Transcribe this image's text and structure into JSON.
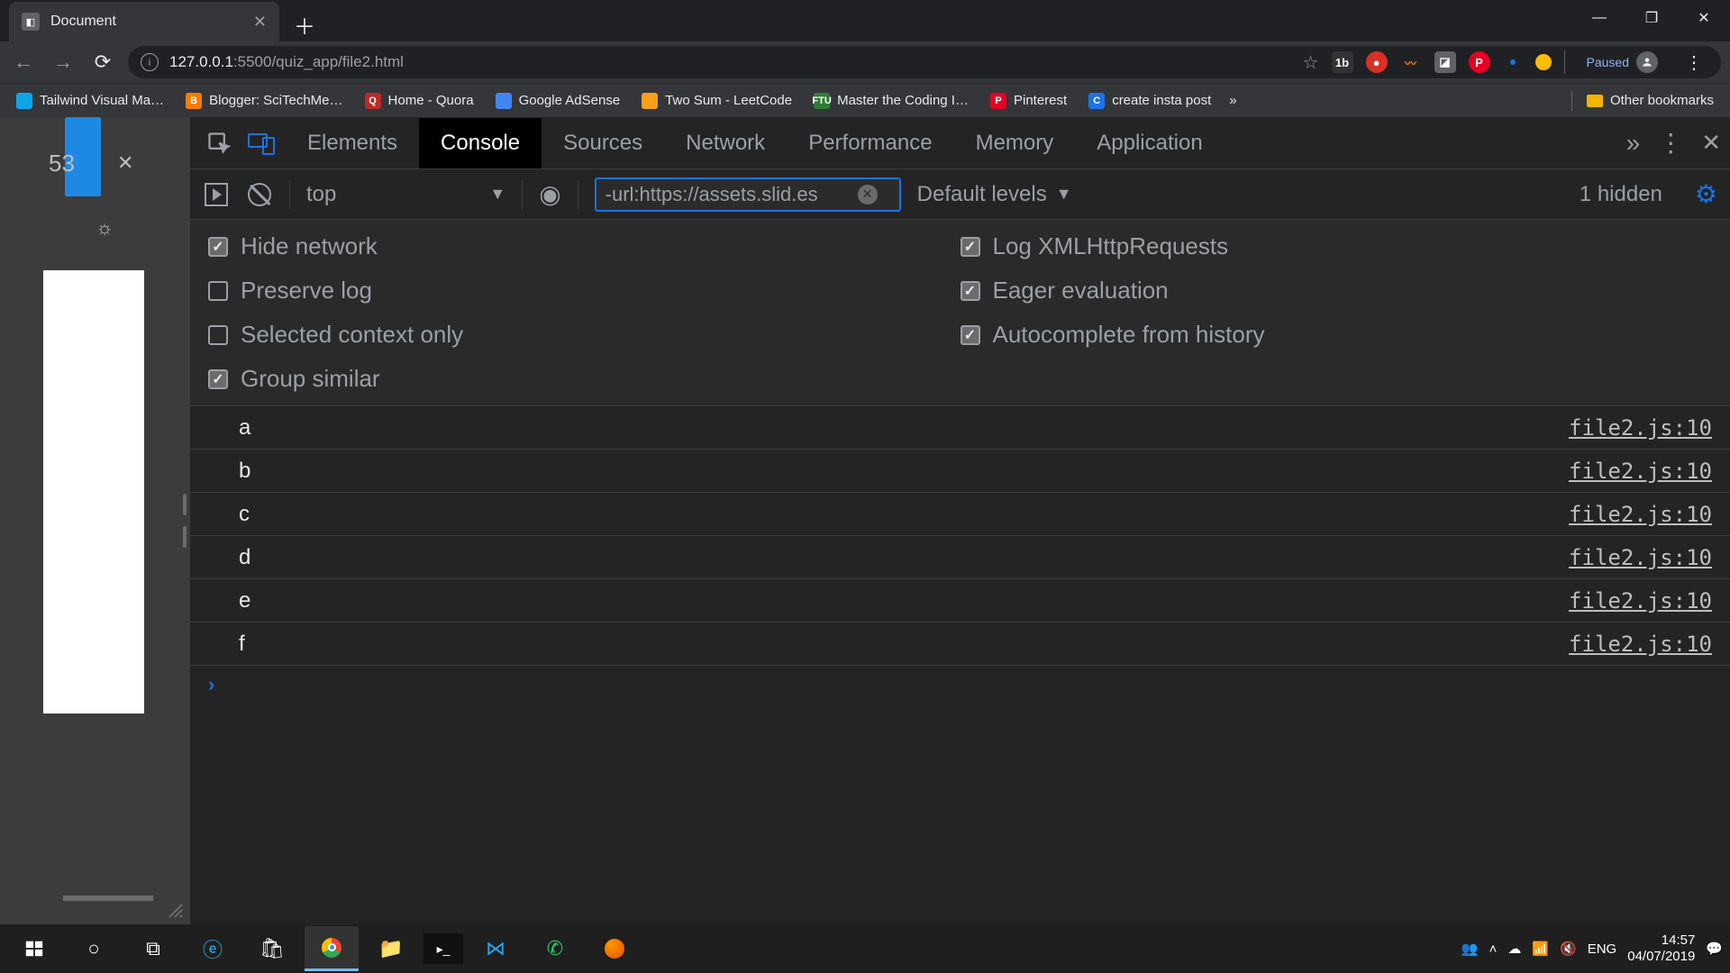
{
  "window": {
    "tab_title": "Document",
    "paused_label": "Paused"
  },
  "address": {
    "host": "127.0.0.1",
    "port": ":5500",
    "path": "/quiz_app/file2.html"
  },
  "bookmarks": {
    "items": [
      {
        "label": "Tailwind  Visual Ma…",
        "color": "#0ea5e9"
      },
      {
        "label": "Blogger: SciTechMe…",
        "color": "#f57c00",
        "initial": "B"
      },
      {
        "label": "Home - Quora",
        "color": "#b92b27",
        "initial": "Q"
      },
      {
        "label": "Google AdSense",
        "color": "#4285f4",
        "initial": ""
      },
      {
        "label": "Two Sum - LeetCode",
        "color": "#f89f1b",
        "initial": ""
      },
      {
        "label": "Master the Coding I…",
        "color": "#2e7d32",
        "initial": "FTU"
      },
      {
        "label": "Pinterest",
        "color": "#e60023",
        "initial": "P"
      },
      {
        "label": "create insta post",
        "color": "#1a73e8",
        "initial": "C"
      }
    ],
    "more": "»",
    "other": "Other bookmarks"
  },
  "page_strip": {
    "page_num": "53",
    "close": "✕"
  },
  "devtools": {
    "tabs": [
      "Elements",
      "Console",
      "Sources",
      "Network",
      "Performance",
      "Memory",
      "Application"
    ],
    "active_tab": "Console",
    "more": "»"
  },
  "console_toolbar": {
    "context": "top",
    "filter_value": "-url:https://assets.slid.es",
    "levels_label": "Default levels",
    "hidden_label": "1 hidden"
  },
  "settings": {
    "left": [
      {
        "label": "Hide network",
        "checked": true
      },
      {
        "label": "Preserve log",
        "checked": false
      },
      {
        "label": "Selected context only",
        "checked": false
      },
      {
        "label": "Group similar",
        "checked": true
      }
    ],
    "right": [
      {
        "label": "Log XMLHttpRequests",
        "checked": true
      },
      {
        "label": "Eager evaluation",
        "checked": true
      },
      {
        "label": "Autocomplete from history",
        "checked": true
      }
    ]
  },
  "logs": [
    {
      "msg": "a",
      "src": "file2.js:10"
    },
    {
      "msg": "b",
      "src": "file2.js:10"
    },
    {
      "msg": "c",
      "src": "file2.js:10"
    },
    {
      "msg": "d",
      "src": "file2.js:10"
    },
    {
      "msg": "e",
      "src": "file2.js:10"
    },
    {
      "msg": "f",
      "src": "file2.js:10"
    }
  ],
  "taskbar": {
    "lang": "ENG",
    "time": "14:57",
    "date": "04/07/2019"
  }
}
